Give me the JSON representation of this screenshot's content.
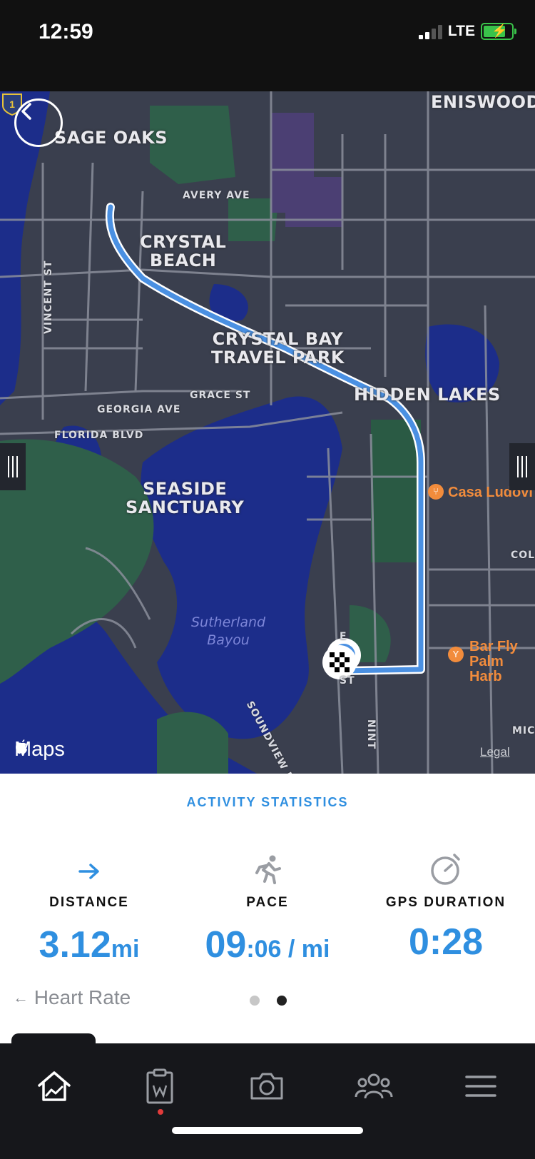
{
  "status_bar": {
    "time": "12:59",
    "network": "LTE"
  },
  "map": {
    "neighborhoods": [
      "ENISWOOD",
      "SAGE OAKS",
      "CRYSTAL\nBEACH",
      "CRYSTAL BAY\nTRAVEL PARK",
      "HIDDEN LAKES",
      "SEASIDE\nSANCTUARY"
    ],
    "streets": [
      "AVERY AVE",
      "VINCENT ST",
      "GRACE ST",
      "GEORGIA AVE",
      "FLORIDA BLVD",
      "SOUNDVIEW DR",
      "NINT",
      "E",
      "ST",
      "COL",
      "MIC"
    ],
    "water": "Sutherland\nBayou",
    "pois": [
      "Casa Ludovi",
      "Bar Fly\nPalm Harb"
    ],
    "route_shield": "1",
    "attribution": "Maps",
    "legal": "Legal",
    "colors": {
      "route": "#4a90e2",
      "water": "#1c2d8a",
      "park": "#2f5f4a",
      "land": "#3a3f4e"
    }
  },
  "stats": {
    "title": "ACTIVITY STATISTICS",
    "distance": {
      "label": "DISTANCE",
      "value": "3.12",
      "unit": "mi"
    },
    "pace": {
      "label": "PACE",
      "value": "09",
      "unit": ":06 / mi"
    },
    "gps": {
      "label": "GPS DURATION",
      "value": "0:28"
    },
    "prev_link": "Heart Rate",
    "page_index": 2,
    "page_count": 2
  },
  "tabbar": {
    "items": [
      "home-icon",
      "plan-icon",
      "camera-icon",
      "community-icon",
      "menu-icon"
    ]
  }
}
